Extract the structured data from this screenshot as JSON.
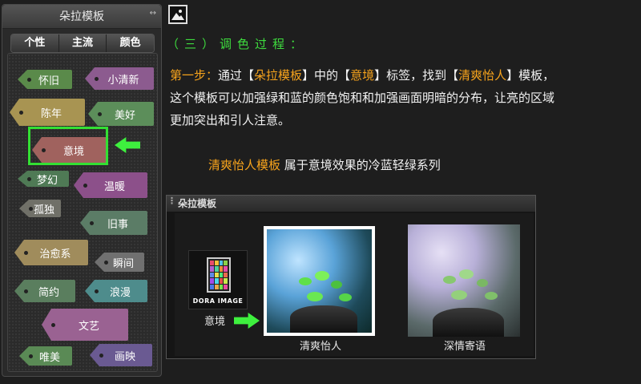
{
  "panel": {
    "title": "朵拉模板",
    "arrows": "↔",
    "tabs": [
      "个性",
      "主流",
      "颜色"
    ],
    "tags": [
      {
        "label": "怀旧",
        "color": "#5a8a4a"
      },
      {
        "label": "小清新",
        "color": "#8c5b8f"
      },
      {
        "label": "陈年",
        "color": "#a89452"
      },
      {
        "label": "美好",
        "color": "#5c8e5a"
      },
      {
        "label": "意境",
        "color": "#a0625e"
      },
      {
        "label": "梦幻",
        "color": "#4f7a55"
      },
      {
        "label": "温暖",
        "color": "#8c508a"
      },
      {
        "label": "孤独",
        "color": "#707068"
      },
      {
        "label": "旧事",
        "color": "#5b7c66"
      },
      {
        "label": "治愈系",
        "color": "#a08c5c"
      },
      {
        "label": "瞬间",
        "color": "#707070"
      },
      {
        "label": "简约",
        "color": "#5a7e5e"
      },
      {
        "label": "浪漫",
        "color": "#4e8c8c"
      },
      {
        "label": "文艺",
        "color": "#9a6292"
      },
      {
        "label": "唯美",
        "color": "#5a8a55"
      },
      {
        "label": "画映",
        "color": "#6a5a92"
      }
    ]
  },
  "content": {
    "step_heading": "（三）调色过程：",
    "para_lead": "第一步：",
    "para_p1": "通过【",
    "para_o1": "朵拉模板",
    "para_p2": "】中的【",
    "para_o2": "意境",
    "para_p3": "】标签，找到【",
    "para_o3": "清爽怡人",
    "para_p4": "】模板，",
    "para_line2": "这个模板可以加强绿和蓝的颜色饱和和加强画面明暗的分布，让亮的区域",
    "para_line3": "更加突出和引人注意。",
    "caption_orange": "清爽怡人模板",
    "caption_rest": " 属于意境效果的冷蓝轻绿系列"
  },
  "preview": {
    "title": "朵拉模板",
    "logo_text": "DORA IMAGE",
    "thumbs": [
      "意境",
      "清爽怡人",
      "深情寄语"
    ]
  },
  "colors": {
    "accent_green": "#3edc3e",
    "accent_orange": "#f6a31c"
  }
}
